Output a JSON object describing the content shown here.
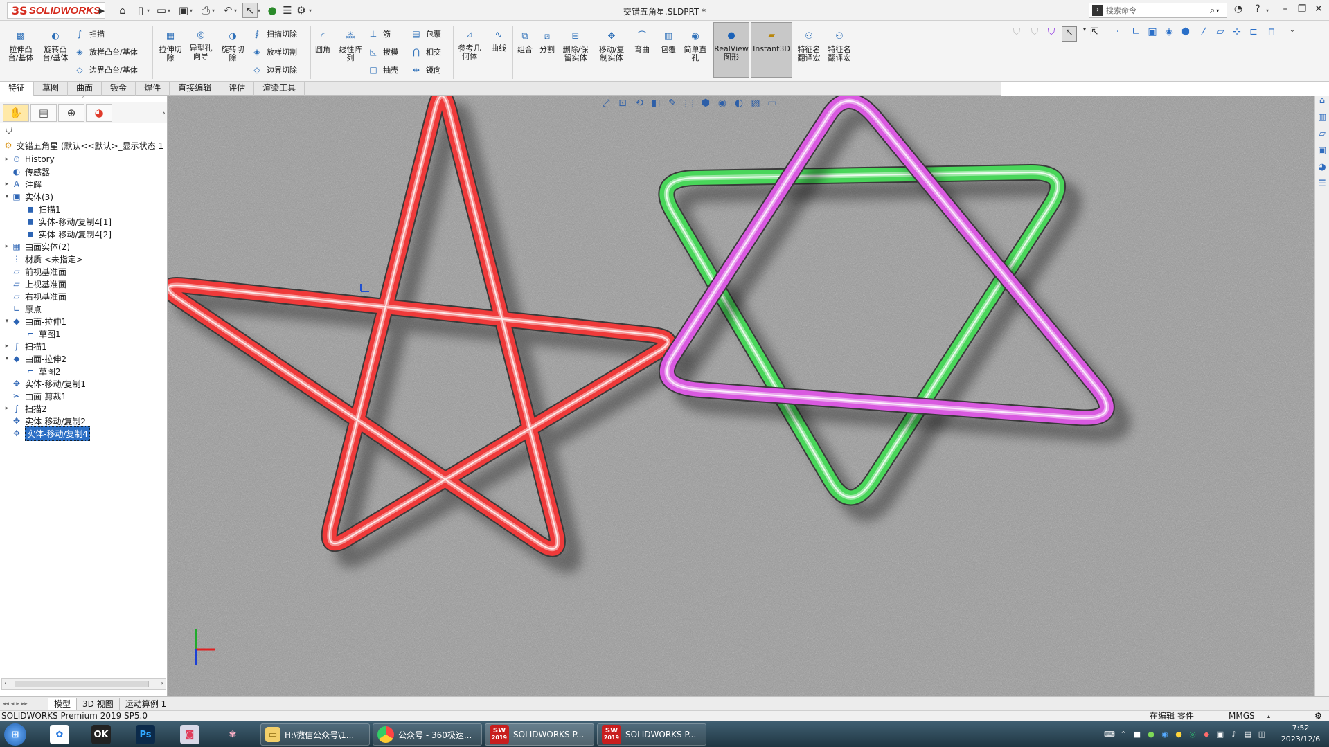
{
  "app": {
    "brand": "SOLIDWORKS",
    "brand_ds": "3S",
    "title": "交错五角星.SLDPRT *"
  },
  "search": {
    "placeholder": "搜索命令"
  },
  "ribbon": {
    "extrude_boss": "拉伸凸\n台/基体",
    "revolve_boss": "旋转凸\n台/基体",
    "sweep": "扫描",
    "loft_boss": "放样凸台/基体",
    "boundary_boss": "边界凸台/基体",
    "extrude_cut": "拉伸切\n除",
    "hole_wizard": "异型孔\n向导",
    "revolve_cut": "旋转切\n除",
    "sweep_cut": "扫描切除",
    "loft_cut": "放样切割",
    "boundary_cut": "边界切除",
    "fillet": "圆角",
    "linear_pattern": "线性阵\n列",
    "rib": "筋",
    "draft": "拔模",
    "shell": "抽壳",
    "wrap": "包覆",
    "intersect": "相交",
    "mirror": "镜向",
    "ref_geometry": "参考几\n何体",
    "curves": "曲线",
    "combine": "组合",
    "split": "分割",
    "delete_keep": "删除/保\n留实体",
    "move_copy": "移动/复\n制实体",
    "flex": "弯曲",
    "wrap2": "包覆",
    "simple_hole": "简单直\n孔",
    "realview": "RealView\n图形",
    "instant3d": "Instant3D",
    "feature_translate1": "特征名\n翻译宏",
    "feature_translate2": "特征名\n翻译宏"
  },
  "tabs": [
    "特征",
    "草图",
    "曲面",
    "钣金",
    "焊件",
    "直接编辑",
    "评估",
    "渲染工具"
  ],
  "tree": {
    "root": "交错五角星 (默认<<默认>_显示状态 1",
    "nodes": [
      {
        "label": "History",
        "icon": "history-icon",
        "expand": "▸"
      },
      {
        "label": "传感器",
        "icon": "sensor-icon",
        "expand": ""
      },
      {
        "label": "注解",
        "icon": "annotation-icon",
        "expand": "▸"
      },
      {
        "label": "实体(3)",
        "icon": "solid-bodies-folder-icon",
        "expand": "▾"
      },
      {
        "label": "扫描1",
        "icon": "solid-body-icon",
        "expand": "",
        "indent": 1
      },
      {
        "label": "实体-移动/复制4[1]",
        "icon": "solid-body-icon",
        "expand": "",
        "indent": 1
      },
      {
        "label": "实体-移动/复制4[2]",
        "icon": "solid-body-icon",
        "expand": "",
        "indent": 1
      },
      {
        "label": "曲面实体(2)",
        "icon": "surface-bodies-folder-icon",
        "expand": "▸"
      },
      {
        "label": "材质 <未指定>",
        "icon": "material-icon",
        "expand": ""
      },
      {
        "label": "前视基准面",
        "icon": "plane-icon",
        "expand": ""
      },
      {
        "label": "上视基准面",
        "icon": "plane-icon",
        "expand": ""
      },
      {
        "label": "右视基准面",
        "icon": "plane-icon",
        "expand": ""
      },
      {
        "label": "原点",
        "icon": "origin-icon",
        "expand": ""
      },
      {
        "label": "曲面-拉伸1",
        "icon": "surface-extrude-icon",
        "expand": "▾"
      },
      {
        "label": "草图1",
        "icon": "sketch-icon",
        "expand": "",
        "indent": 1
      },
      {
        "label": "扫描1",
        "icon": "sweep-icon",
        "expand": "▸"
      },
      {
        "label": "曲面-拉伸2",
        "icon": "surface-extrude-icon",
        "expand": "▾"
      },
      {
        "label": "草图2",
        "icon": "sketch-icon",
        "expand": "",
        "indent": 1
      },
      {
        "label": "实体-移动/复制1",
        "icon": "move-copy-icon",
        "expand": ""
      },
      {
        "label": "曲面-剪裁1",
        "icon": "surface-trim-icon",
        "expand": ""
      },
      {
        "label": "扫描2",
        "icon": "sweep-icon",
        "expand": "▸"
      },
      {
        "label": "实体-移动/复制2",
        "icon": "move-copy-icon",
        "expand": ""
      },
      {
        "label": "实体-移动/复制4",
        "icon": "move-copy-icon",
        "expand": "",
        "selected": true
      }
    ]
  },
  "bottom_tabs": [
    "模型",
    "3D 视图",
    "运动算例 1"
  ],
  "status": {
    "product": "SOLIDWORKS Premium 2019 SP5.0",
    "mode": "在编辑 零件",
    "units": "MMGS"
  },
  "taskbar": {
    "folder": "H:\\微信公众号\\1...",
    "browser": "公众号 - 360极速...",
    "sw1": "SOLIDWORKS P...",
    "sw2": "SOLIDWORKS P...",
    "sw_year": "2019",
    "time": "7:52",
    "date": "2023/12/6"
  },
  "colors": {
    "star_red": "#ef3a3a",
    "star_green": "#49d65a",
    "star_magenta": "#d95ae0",
    "selection": "#2b6fc6"
  }
}
